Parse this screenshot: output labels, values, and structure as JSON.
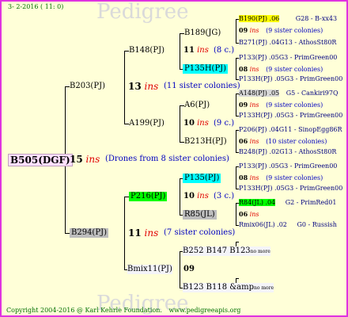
{
  "header": {
    "date": "3- 2-2016 ( 11: 0)"
  },
  "footer": {
    "copyright": "Copyright 2004-2016 @ Karl Kehrle Foundation.",
    "site": "www.pedigreeapis.org"
  },
  "watermark": "Pedigree",
  "root": {
    "id": "B505(DGF)",
    "year": "15",
    "ins": "ins",
    "note": "(Drones from 8 sister colonies)"
  },
  "gen1": [
    {
      "id": "B203(PJ)",
      "year": "13",
      "ins": "ins",
      "note": "(11 sister colonies)"
    },
    {
      "id": "B294(PJ)",
      "year": "11",
      "ins": "ins",
      "note": "(7 sister colonies)"
    }
  ],
  "gen2": [
    {
      "id": "B148(PJ)",
      "year": "11",
      "ins": "ins",
      "note": "(8 c.)"
    },
    {
      "id": "A199(PJ)",
      "year": "10",
      "ins": "ins",
      "note": "(9 c.)"
    },
    {
      "id": "P216(PJ)",
      "year": "10",
      "ins": "ins",
      "note": "(3 c.)"
    },
    {
      "id": "Bmix11(PJ)",
      "year": "09"
    }
  ],
  "gen3": [
    {
      "id": "B189(JG)"
    },
    {
      "id": "P135H(PJ)"
    },
    {
      "id": "A6(PJ)"
    },
    {
      "id": "B213H(PJ)"
    },
    {
      "id": "P135(PJ)"
    },
    {
      "id": "R85(JL)"
    },
    {
      "id": "B252 B147 B123",
      "tag": "no more"
    },
    {
      "id": "B123 B118 &amp",
      "tag": "no more"
    }
  ],
  "gen4": [
    {
      "queen": "B190(PJ) .06",
      "line": "G28 - B-xx43",
      "year": "09",
      "ins": "ins",
      "note": "(9 sister colonies)",
      "drone": "B271(PJ) .04G13 - AthosSt80R"
    },
    {
      "queen": "P133(PJ) .05G3 - PrimGreen00",
      "year": "08",
      "ins": "ins",
      "note": "(9 sister colonies)",
      "drone": "P133H(PJ) .05G3 - PrimGreen00"
    },
    {
      "queen": "A148(PJ) .05",
      "line": "G5 - Cankiri97Q",
      "year": "09",
      "ins": "ins",
      "note": "(9 sister colonies)",
      "drone": "P133H(PJ) .05G3 - PrimGreen00"
    },
    {
      "queen": "P206(PJ) .04G11 - SinopEgg86R",
      "year": "06",
      "ins": "ins",
      "note": "(10 sister colonies)",
      "drone": "B248(PJ) .02G13 - AthosSt80R"
    },
    {
      "queen": "P133(PJ) .05G3 - PrimGreen00",
      "year": "08",
      "ins": "ins",
      "note": "(9 sister colonies)",
      "drone": "P133H(PJ) .05G3 - PrimGreen00"
    },
    {
      "queen": "R84(JL) .04",
      "line": "G2 - PrimRed01",
      "year": "06",
      "ins": "ins",
      "drone": "Rmix06(JL) .02",
      "drone_line": "G0 - Russish"
    }
  ]
}
